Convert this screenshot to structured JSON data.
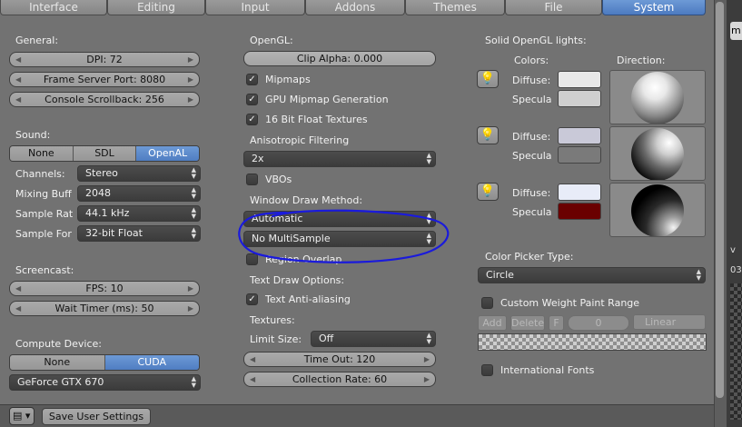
{
  "tabs": [
    {
      "label": "Interface",
      "active": false
    },
    {
      "label": "Editing",
      "active": false
    },
    {
      "label": "Input",
      "active": false
    },
    {
      "label": "Addons",
      "active": false
    },
    {
      "label": "Themes",
      "active": false
    },
    {
      "label": "File",
      "active": false
    },
    {
      "label": "System",
      "active": true
    }
  ],
  "general": {
    "header": "General:",
    "dpi": "DPI: 72",
    "frame_server_port": "Frame Server Port: 8080",
    "console_scrollback": "Console Scrollback: 256"
  },
  "sound": {
    "header": "Sound:",
    "options": [
      "None",
      "SDL",
      "OpenAL"
    ],
    "selected": "OpenAL",
    "channels_label": "Channels:",
    "channels_value": "Stereo",
    "mixing_label": "Mixing Buff",
    "mixing_value": "2048",
    "sample_rate_label": "Sample Rat",
    "sample_rate_value": "44.1 kHz",
    "sample_format_label": "Sample For",
    "sample_format_value": "32-bit Float"
  },
  "screencast": {
    "header": "Screencast:",
    "fps": "FPS: 10",
    "wait_timer": "Wait Timer (ms): 50"
  },
  "compute": {
    "header": "Compute Device:",
    "options": [
      "None",
      "CUDA"
    ],
    "selected": "CUDA",
    "device": "GeForce GTX 670"
  },
  "opengl": {
    "header": "OpenGL:",
    "clip_alpha": "Clip Alpha: 0.000",
    "mipmaps_label": "Mipmaps",
    "mipmaps_checked": true,
    "gpu_mipmap_label": "GPU Mipmap Generation",
    "gpu_mipmap_checked": true,
    "float_textures_label": "16 Bit Float Textures",
    "float_textures_checked": true,
    "aniso_label": "Anisotropic Filtering",
    "aniso_value": "2x",
    "vbos_label": "VBOs",
    "vbos_checked": false,
    "window_draw_label": "Window Draw Method:",
    "window_draw_value": "Automatic",
    "multisample_value": "No MultiSample",
    "region_overlap_label": "Region Overlap",
    "region_overlap_checked": false,
    "text_draw_label": "Text Draw Options:",
    "text_aa_label": "Text Anti-aliasing",
    "text_aa_checked": true,
    "textures_label": "Textures:",
    "limit_size_label": "Limit Size:",
    "limit_size_value": "Off",
    "time_out": "Time Out: 120",
    "collection_rate": "Collection Rate: 60"
  },
  "lights": {
    "header": "Solid OpenGL lights:",
    "colors_label": "Colors:",
    "direction_label": "Direction:",
    "diffuse_label": "Diffuse:",
    "specular_label": "Specula",
    "items": [
      {
        "diffuse": "#e8e8e8",
        "specular": "#cfcfcf"
      },
      {
        "diffuse": "#c9c9d8",
        "specular": "#7a7a7a"
      },
      {
        "diffuse": "#e8ecf8",
        "specular": "#6a0000"
      }
    ]
  },
  "color_picker": {
    "label": "Color Picker Type:",
    "value": "Circle"
  },
  "weight_paint": {
    "label": "Custom Weight Paint Range",
    "checked": false,
    "add": "Add",
    "delete": "Delete",
    "f": "F",
    "value": "0",
    "interpolation": "Linear"
  },
  "international_fonts": {
    "label": "International Fonts",
    "checked": false
  },
  "bottom": {
    "save_label": "Save User Settings"
  },
  "right_strip": {
    "tab_text": "m",
    "label_v": "v",
    "label_03": "03"
  },
  "colors": {
    "active_blue": "#5a87c8",
    "annotation": "#1a1adc"
  }
}
